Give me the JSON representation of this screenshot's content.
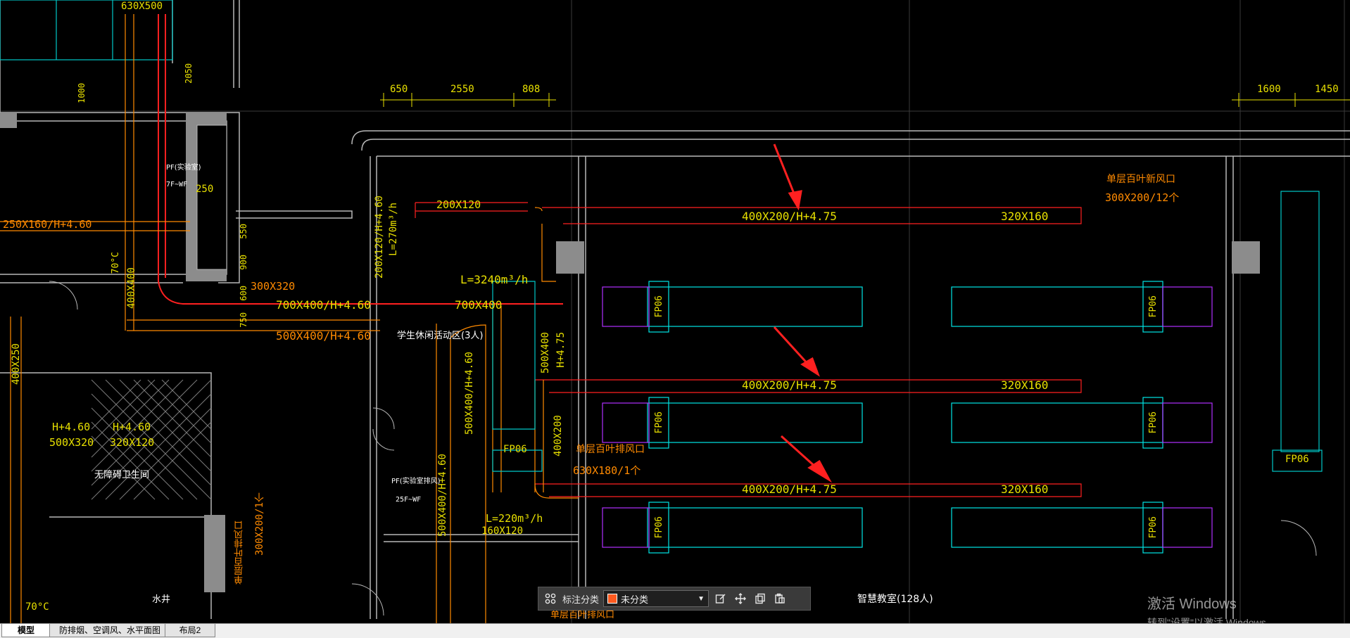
{
  "drawing": {
    "dimensions": {
      "d650": "650",
      "d2550": "2550",
      "d808": "808",
      "d1600": "1600",
      "d1450": "1450",
      "d630x500": "630X500",
      "d550": "550",
      "d900": "900",
      "d600": "600",
      "d750": "750",
      "d250": "250",
      "d2050": "2050",
      "d1000": "1000"
    },
    "labels": {
      "duct_200x120": "200X120",
      "duct_400x200_1": "400X200/H+4.75",
      "duct_400x200_2": "400X200/H+4.75",
      "duct_400x200_3": "400X200/H+4.75",
      "duct_320x160_1": "320X160",
      "duct_320x160_2": "320X160",
      "duct_320x160_3": "320X160",
      "louver_supply": "单层百叶新风口",
      "louver_supply_spec": "300X200/12个",
      "louver_exhaust": "单层百叶排风口",
      "louver_exhaust_spec": "630X180/1个",
      "flow_3240": "L=3240m³/h",
      "flow_270": "L=270m³/h",
      "flow_220": "L=220m³/h",
      "duct_700x400_a": "700X400/H+4.60",
      "duct_700x400_b": "700X400",
      "duct_500x400": "500X400/H+4.60",
      "duct_300x320": "300X320",
      "duct_250x160": "250X160/H+4.60",
      "duct_160x120": "160X120",
      "v_200x120": "200X120/H+4.60",
      "v_500x400_a": "500X400/H+4.60",
      "v_500x400_b": "500X400/H+4.60",
      "v_500x400_c": "500X400",
      "v_h475": "H+4.75",
      "v_400x200": "400X200",
      "v_400x400": "400X400",
      "v_400x250": "400X250",
      "h460_a": "H+4.60",
      "h460_b": "H+4.60",
      "d500x320": "500X320",
      "d320x120": "320X120",
      "room_rest": "学生休闲活动区(3人)",
      "room_classroom": "智慧教室(128人)",
      "room_wc": "无障碍卫生间",
      "room_well": "水井",
      "tag_fp06_1": "FP06",
      "tag_fp06_2": "FP06",
      "tag_fp06_3": "FP06",
      "tag_fp06_4": "FP06",
      "tag_fp06_5": "FP06",
      "tag_fp06_6": "FP06",
      "tag_fp06_7": "FP06",
      "tag_fp06_8": "FP06",
      "temp_70": "70°C",
      "temp_70b": "70°C",
      "pf_tag": "PF(实验室排风)",
      "pf_floor": "25F~WF",
      "pf_tag2": "PF(实验室)",
      "pf_floor2": "7F~WF",
      "v_300x200": "300X200/1个",
      "v_single_exhaust": "单层百叶排风口",
      "bottom_exhaust": "单层百叶排风口"
    }
  },
  "toolbar": {
    "category_label": "标注分类",
    "category_value": "未分类",
    "category_color": "#ff5a1f"
  },
  "watermark": {
    "line1": "激活 Windows",
    "line2": "转到\"设置\"以激活 Windows。"
  },
  "tabs": [
    "模型",
    "防排烟、空调风、水平面图",
    "布局2"
  ],
  "colors": {
    "background": "#000000",
    "dim_yellow": "#e8e000",
    "duct_orange": "#ff8a00",
    "duct_red": "#ff2020",
    "unit_cyan": "#00e5e5",
    "unit_purple": "#b030ff",
    "wall_gray": "#b8b8b8"
  }
}
